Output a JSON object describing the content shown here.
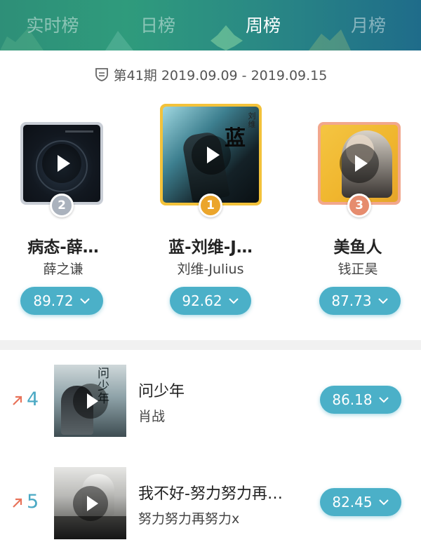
{
  "tabs": [
    {
      "label": "实时榜",
      "active": false
    },
    {
      "label": "日榜",
      "active": false
    },
    {
      "label": "周榜",
      "active": true
    },
    {
      "label": "月榜",
      "active": false
    }
  ],
  "period": {
    "icon": "shield-icon",
    "text": "第41期 2019.09.09 - 2019.09.15"
  },
  "podium": [
    {
      "rank": "2",
      "title": "病态-薛…",
      "artist": "薛之谦",
      "score": "89.72",
      "frame_color": "#c9ced6",
      "medal_color": "#aab2bd"
    },
    {
      "rank": "1",
      "title": "蓝-刘维-J…",
      "artist": "刘维-Julius",
      "score": "92.62",
      "frame_color": "#f3c23a",
      "medal_color": "#eba52b"
    },
    {
      "rank": "3",
      "title": "美鱼人",
      "artist": "钱正昊",
      "score": "87.73",
      "frame_color": "#f2a78c",
      "medal_color": "#e68c6e"
    }
  ],
  "cover_text": {
    "podium_1": "蓝",
    "podium_1_sub": "刘维",
    "list_4": "问少年"
  },
  "list": [
    {
      "rank": "4",
      "trend": "up",
      "title": "问少年",
      "artist": "肖战",
      "score": "86.18"
    },
    {
      "rank": "5",
      "trend": "up",
      "title": "我不好-努力努力再…",
      "artist": "努力努力再努力x",
      "score": "82.45"
    }
  ],
  "colors": {
    "accent": "#4bb0c8",
    "rank_text": "#4ba9c4",
    "trend_up": "#e8735a"
  }
}
